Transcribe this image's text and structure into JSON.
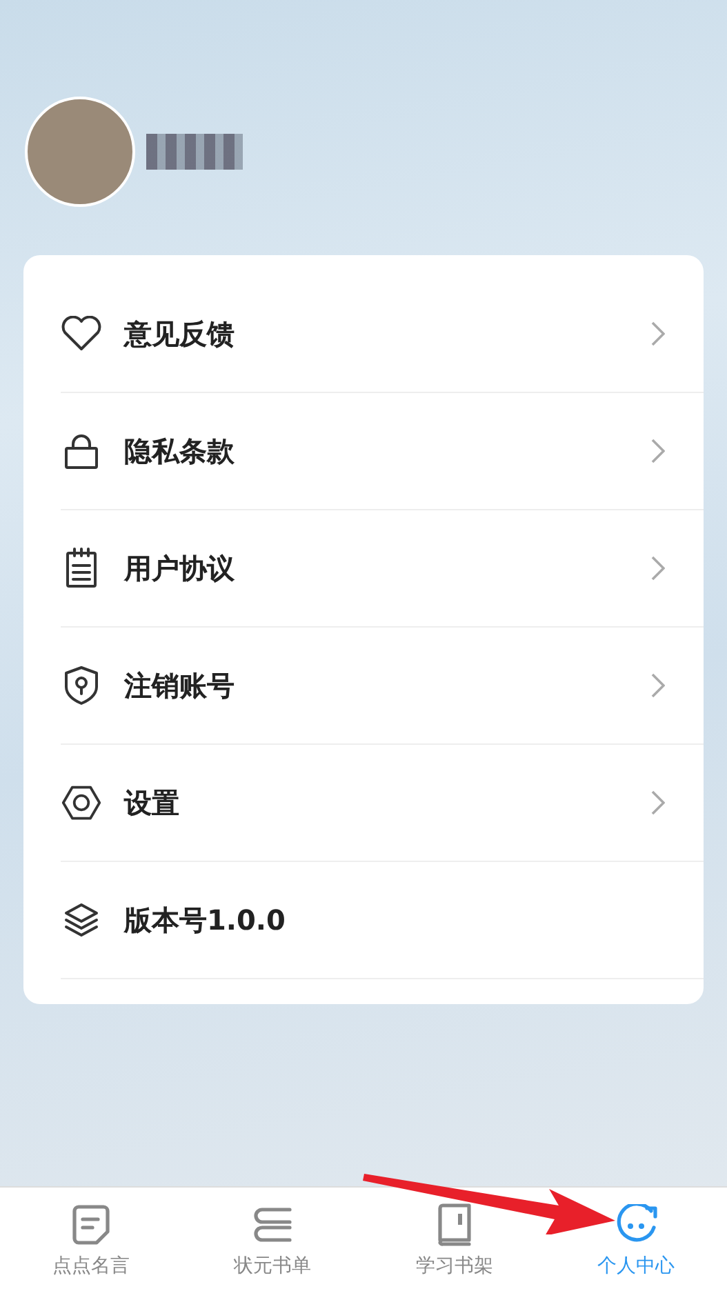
{
  "menu": {
    "items": [
      {
        "label": "意见反馈",
        "kind": "link"
      },
      {
        "label": "隐私条款",
        "kind": "link"
      },
      {
        "label": "用户协议",
        "kind": "link"
      },
      {
        "label": "注销账号",
        "kind": "link"
      },
      {
        "label": "设置",
        "kind": "link"
      },
      {
        "label": "版本号1.0.0",
        "kind": "info"
      }
    ]
  },
  "tab_bar": {
    "tabs": [
      {
        "label": "点点名言",
        "selected": false
      },
      {
        "label": "状元书单",
        "selected": false
      },
      {
        "label": "学习书架",
        "selected": false
      },
      {
        "label": "个人中心",
        "selected": true
      }
    ]
  }
}
